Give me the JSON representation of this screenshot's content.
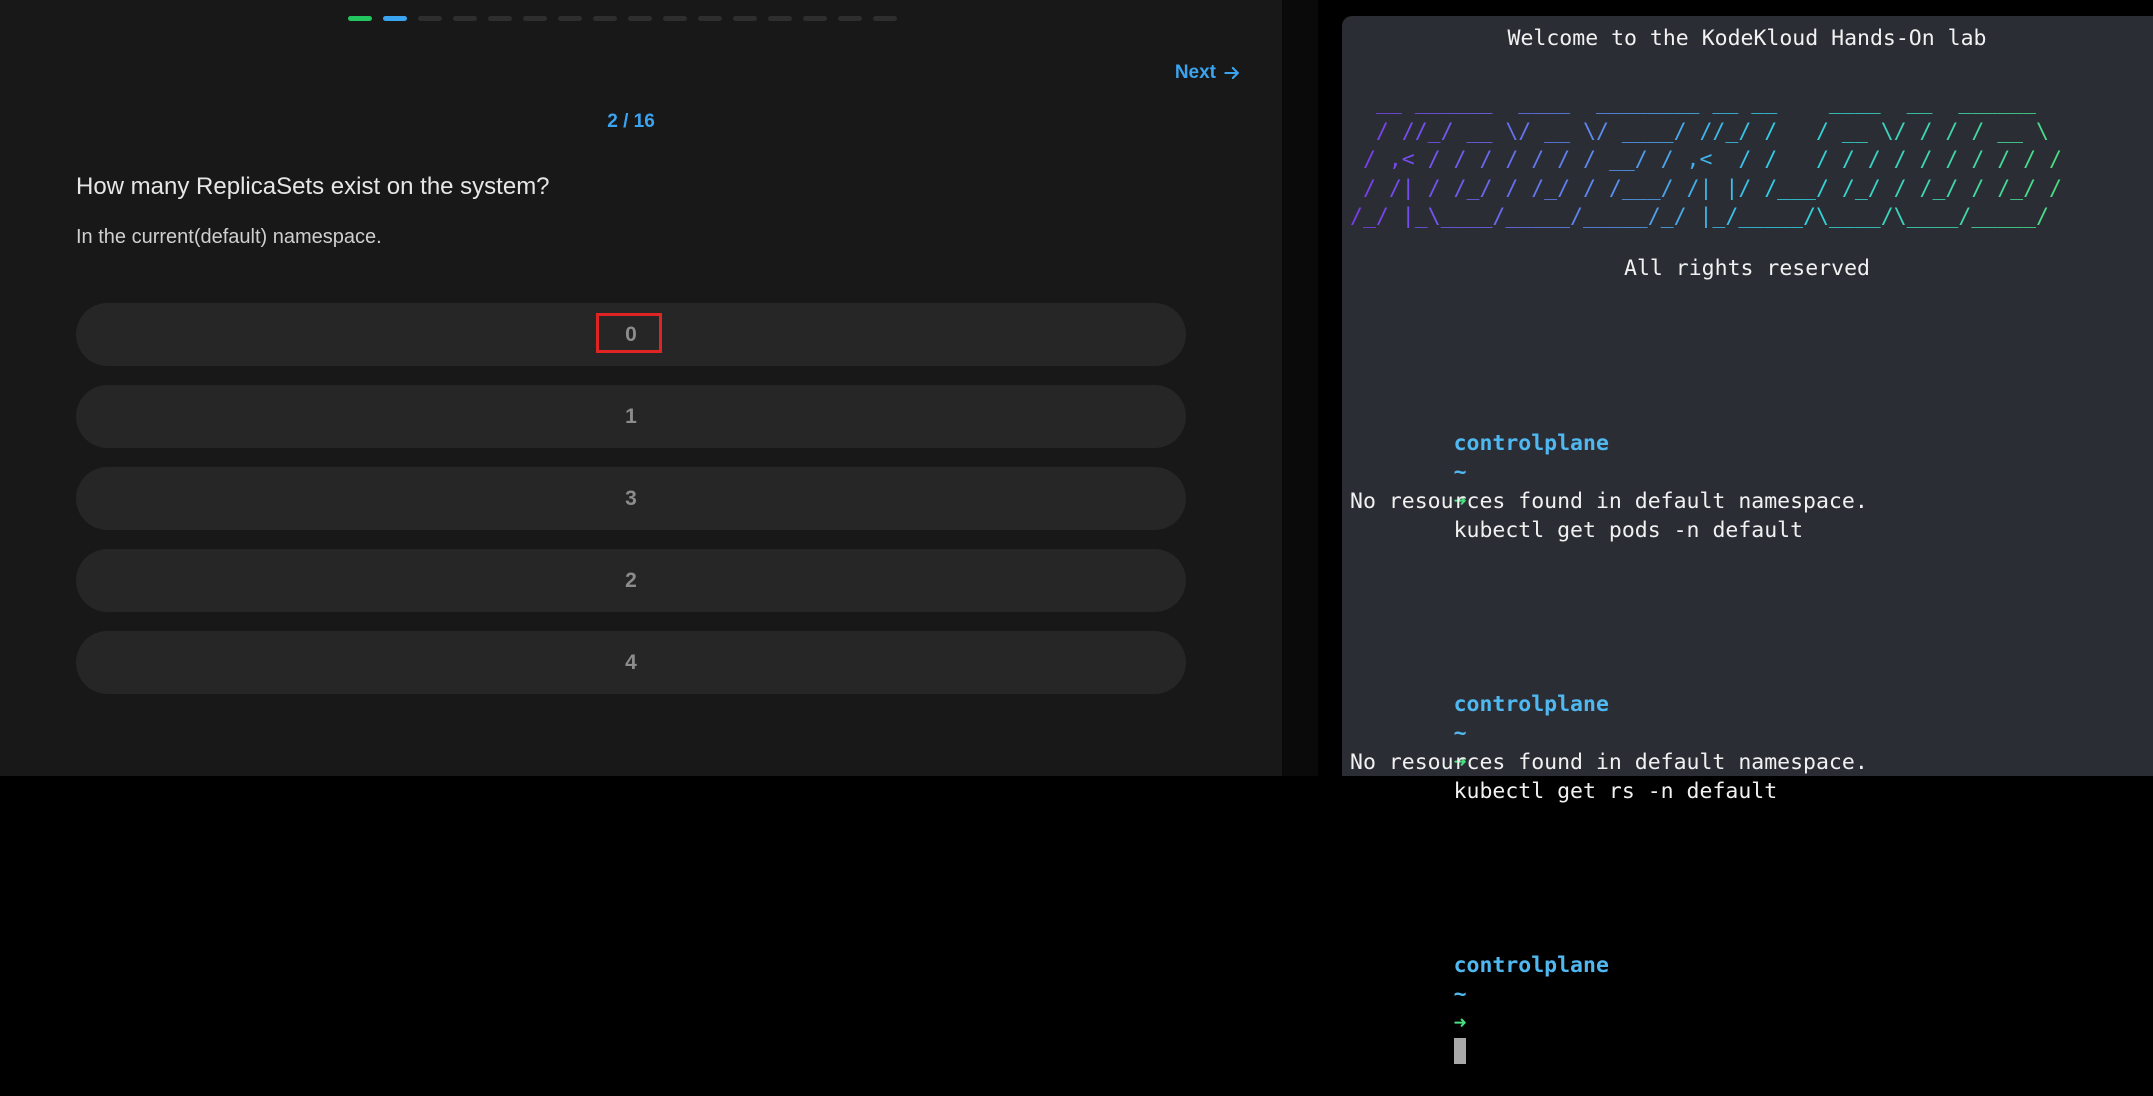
{
  "quiz": {
    "progress": {
      "total": 16,
      "done": 1,
      "current": 2
    },
    "next_label": "Next",
    "counter": "2 / 16",
    "question": "How many ReplicaSets exist on the system?",
    "subtext": "In the current(default) namespace.",
    "options": [
      "0",
      "1",
      "3",
      "2",
      "4"
    ],
    "highlighted_option": "0"
  },
  "terminal": {
    "welcome": "Welcome to the KodeKloud Hands-On lab",
    "ascii_art": [
      "  __ ______  ____  ________ __ __    ____  __  ______",
      "  / //_/ __ \\/ __ \\/ ____/ //_/ /   / __ \\/ / / / __ \\",
      " / ,< / / / / / / / __/ / ,<  / /   / / / / / / / / / /",
      " / /| / /_/ / /_/ / /___/ /| |/ /___/ /_/ / /_/ / /_/ /",
      "/_/ |_\\____/_____/_____/_/ |_/_____/\\____/\\____/_____/"
    ],
    "rights": "All rights reserved",
    "prompt_host": "controlplane",
    "prompt_tilde": "~",
    "prompt_arrow": "➜",
    "commands": [
      {
        "cmd": "kubectl get pods -n default",
        "output": "No resources found in default namespace."
      },
      {
        "cmd": "kubectl get rs -n default",
        "output": "No resources found in default namespace."
      }
    ]
  },
  "colors": {
    "accent": "#3ba4f0",
    "done": "#22c55e",
    "highlight": "#e02424",
    "terminal_bg": "#2b2d35"
  }
}
